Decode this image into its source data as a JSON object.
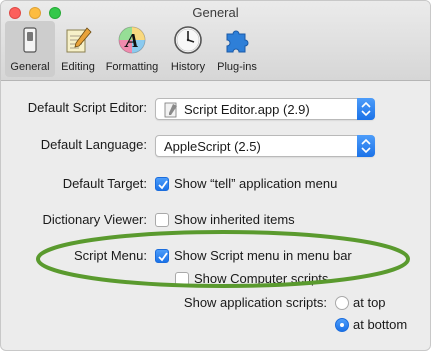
{
  "window": {
    "title": "General"
  },
  "toolbar": {
    "items": [
      {
        "label": "General",
        "icon": "general-switch-icon"
      },
      {
        "label": "Editing",
        "icon": "notepad-pencil-icon"
      },
      {
        "label": "Formatting",
        "icon": "font-a-icon"
      },
      {
        "label": "History",
        "icon": "clock-icon"
      },
      {
        "label": "Plug-ins",
        "icon": "puzzle-icon"
      }
    ],
    "selected": "General"
  },
  "settings": {
    "script_editor": {
      "label": "Default Script Editor:",
      "value": "Script Editor.app (2.9)"
    },
    "language": {
      "label": "Default Language:",
      "value": "AppleScript (2.5)"
    },
    "target": {
      "label": "Default Target:",
      "checkbox_label": "Show “tell” application menu",
      "checked": true
    },
    "dictionary": {
      "label": "Dictionary Viewer:",
      "checkbox_label": "Show inherited items",
      "checked": false
    },
    "script_menu": {
      "label": "Script Menu:",
      "show_menu_label": "Show Script menu in menu bar",
      "show_menu_checked": true,
      "computer_scripts_label": "Show Computer scripts",
      "computer_scripts_checked": false
    },
    "app_scripts": {
      "label": "Show application scripts:",
      "options": [
        "at top",
        "at bottom"
      ],
      "selected": "at bottom"
    }
  },
  "colors": {
    "accent": "#1b72e8",
    "highlight_oval": "#5a9a2e"
  }
}
